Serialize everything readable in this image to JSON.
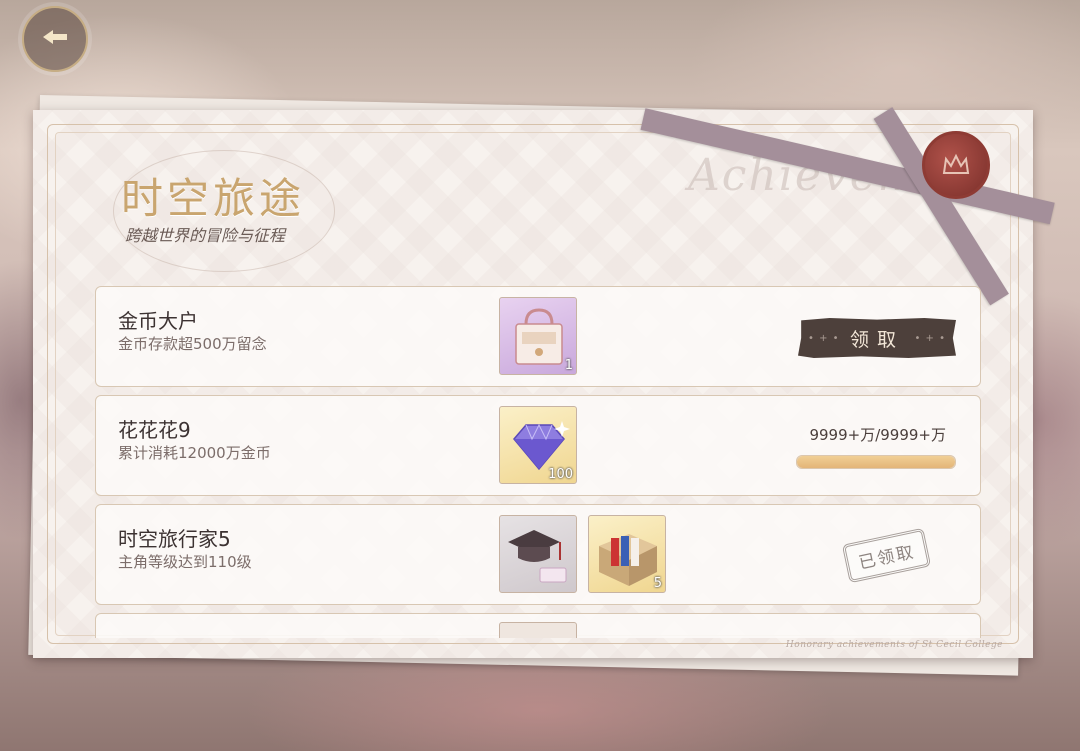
{
  "header": {
    "back_icon": "back-arrow-icon"
  },
  "card": {
    "title": "时空旅途",
    "subtitle": "跨越世界的冒险与征程",
    "watermark": "Achieveme",
    "footer": "Honorary achievements of St Cecil College"
  },
  "achievements": [
    {
      "name": "金币大户",
      "desc": "金币存款超500万留念",
      "rewards": [
        {
          "icon": "handbag-icon",
          "count": "1"
        }
      ],
      "status": "claim",
      "button_label": "领取"
    },
    {
      "name": "花花花9",
      "desc": "累计消耗12000万金币",
      "rewards": [
        {
          "icon": "diamond-icon",
          "count": "100"
        }
      ],
      "status": "progress",
      "progress_text": "9999+万/9999+万",
      "progress": 1.0
    },
    {
      "name": "时空旅行家5",
      "desc": "主角等级达到110级",
      "rewards": [
        {
          "icon": "graduation-cap-icon",
          "count": ""
        },
        {
          "icon": "gift-box-icon",
          "count": "5"
        }
      ],
      "status": "claimed",
      "stamp_label": "已领取"
    }
  ],
  "colors": {
    "title_gold": "#c9a56f",
    "button_dark": "#4d403b",
    "progress_fill": "#e3b578",
    "seal_red": "#8e3b34"
  }
}
